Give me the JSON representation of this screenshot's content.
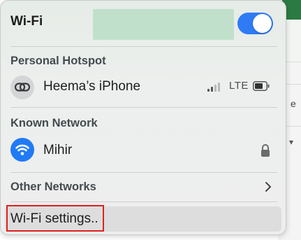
{
  "wifi": {
    "title": "Wi-Fi",
    "enabled": true,
    "toggle_color": "#2f7bf6"
  },
  "personal_hotspot": {
    "section_title": "Personal Hotspot",
    "device_name": "Heema’s iPhone",
    "network_type": "LTE",
    "icon": "hotspot-link-icon"
  },
  "known_network": {
    "section_title": "Known Network",
    "network_name": "Mihir",
    "icon": "wifi-icon",
    "secured": true,
    "accent_color": "#1f7bf5"
  },
  "other_networks": {
    "label": "Other Networks"
  },
  "settings": {
    "label": "Wi-Fi settings..",
    "highlight_color": "#e02020"
  }
}
